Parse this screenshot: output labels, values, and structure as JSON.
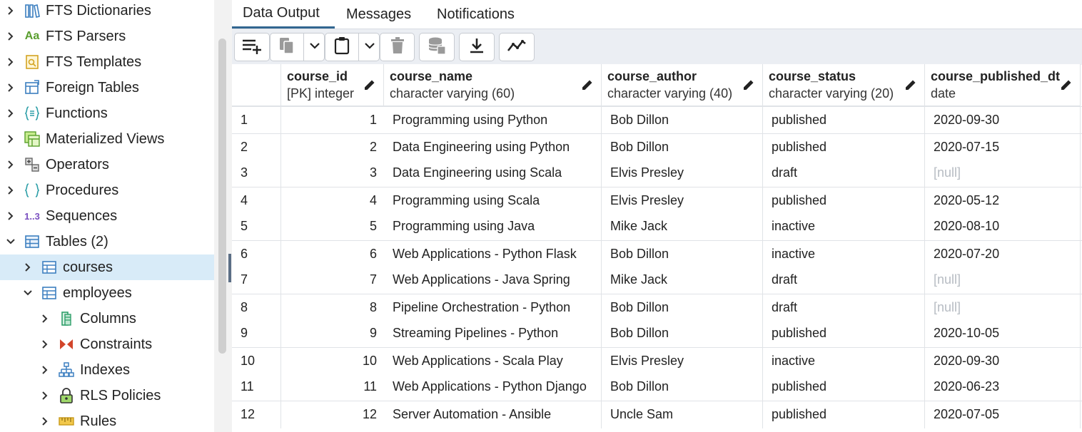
{
  "tree": {
    "items": [
      {
        "label": "FTS Dictionaries",
        "icon": "fts-dictionaries-icon",
        "state": "collapsed"
      },
      {
        "label": "FTS Parsers",
        "icon": "fts-parsers-icon",
        "state": "collapsed"
      },
      {
        "label": "FTS Templates",
        "icon": "fts-templates-icon",
        "state": "collapsed"
      },
      {
        "label": "Foreign Tables",
        "icon": "foreign-tables-icon",
        "state": "collapsed"
      },
      {
        "label": "Functions",
        "icon": "functions-icon",
        "state": "collapsed"
      },
      {
        "label": "Materialized Views",
        "icon": "materialized-views-icon",
        "state": "collapsed"
      },
      {
        "label": "Operators",
        "icon": "operators-icon",
        "state": "collapsed"
      },
      {
        "label": "Procedures",
        "icon": "procedures-icon",
        "state": "collapsed"
      },
      {
        "label": "Sequences",
        "icon": "sequences-icon",
        "state": "collapsed"
      },
      {
        "label": "Tables (2)",
        "icon": "tables-icon",
        "state": "expanded"
      },
      {
        "label": "courses",
        "icon": "table-icon",
        "state": "collapsed",
        "selected": true
      },
      {
        "label": "employees",
        "icon": "table-icon",
        "state": "expanded"
      },
      {
        "label": "Columns",
        "icon": "columns-icon",
        "state": "collapsed"
      },
      {
        "label": "Constraints",
        "icon": "constraints-icon",
        "state": "collapsed"
      },
      {
        "label": "Indexes",
        "icon": "indexes-icon",
        "state": "collapsed"
      },
      {
        "label": "RLS Policies",
        "icon": "rls-policies-icon",
        "state": "collapsed"
      },
      {
        "label": "Rules",
        "icon": "rules-icon",
        "state": "collapsed"
      }
    ]
  },
  "tabs": [
    {
      "label": "Data Output",
      "active": true
    },
    {
      "label": "Messages",
      "active": false
    },
    {
      "label": "Notifications",
      "active": false
    }
  ],
  "toolbar": {
    "buttons": [
      "add-row-icon",
      "copy-icon",
      "paste-icon",
      "delete-icon",
      "save-data-icon",
      "download-icon",
      "graph-visualiser-icon"
    ]
  },
  "grid": {
    "columns": [
      {
        "name": "course_id",
        "type": "[PK] integer"
      },
      {
        "name": "course_name",
        "type": "character varying (60)"
      },
      {
        "name": "course_author",
        "type": "character varying (40)"
      },
      {
        "name": "course_status",
        "type": "character varying (20)"
      },
      {
        "name": "course_published_dt",
        "type": "date"
      }
    ],
    "rows": [
      {
        "n": "1",
        "id": "1",
        "name": "Programming using Python",
        "author": "Bob Dillon",
        "status": "published",
        "date": "2020-09-30"
      },
      {
        "n": "2",
        "id": "2",
        "name": "Data Engineering using Python",
        "author": "Bob Dillon",
        "status": "published",
        "date": "2020-07-15"
      },
      {
        "n": "3",
        "id": "3",
        "name": "Data Engineering using Scala",
        "author": "Elvis Presley",
        "status": "draft",
        "date": "[null]"
      },
      {
        "n": "4",
        "id": "4",
        "name": "Programming using Scala",
        "author": "Elvis Presley",
        "status": "published",
        "date": "2020-05-12"
      },
      {
        "n": "5",
        "id": "5",
        "name": "Programming using Java",
        "author": "Mike Jack",
        "status": "inactive",
        "date": "2020-08-10"
      },
      {
        "n": "6",
        "id": "6",
        "name": "Web Applications - Python Flask",
        "author": "Bob Dillon",
        "status": "inactive",
        "date": "2020-07-20"
      },
      {
        "n": "7",
        "id": "7",
        "name": "Web Applications - Java Spring",
        "author": "Mike Jack",
        "status": "draft",
        "date": "[null]"
      },
      {
        "n": "8",
        "id": "8",
        "name": "Pipeline Orchestration - Python",
        "author": "Bob Dillon",
        "status": "draft",
        "date": "[null]"
      },
      {
        "n": "9",
        "id": "9",
        "name": "Streaming Pipelines - Python",
        "author": "Bob Dillon",
        "status": "published",
        "date": "2020-10-05"
      },
      {
        "n": "10",
        "id": "10",
        "name": "Web Applications - Scala Play",
        "author": "Elvis Presley",
        "status": "inactive",
        "date": "2020-09-30"
      },
      {
        "n": "11",
        "id": "11",
        "name": "Web Applications - Python Django",
        "author": "Bob Dillon",
        "status": "published",
        "date": "2020-06-23"
      },
      {
        "n": "12",
        "id": "12",
        "name": "Server Automation - Ansible",
        "author": "Uncle Sam",
        "status": "published",
        "date": "2020-07-05"
      }
    ]
  }
}
